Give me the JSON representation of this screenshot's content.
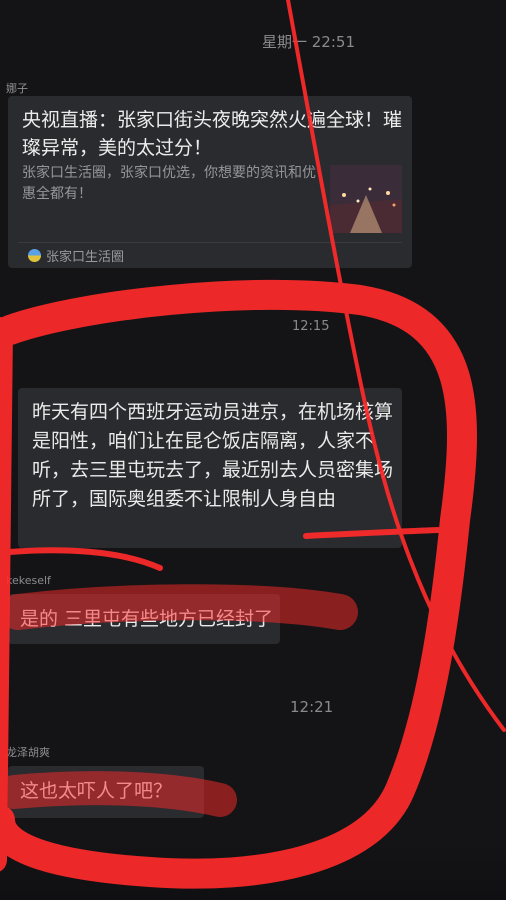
{
  "timestamps": {
    "top": "星期一 22:51",
    "mid1": "12:15",
    "mid2": "12:21"
  },
  "senders": {
    "card_sender": "娜子",
    "msg2_sender": "kekeself",
    "msg3_sender": "龙泽胡爽"
  },
  "card": {
    "title": "央视直播：张家口街头夜晚突然火遍全球！璀璨异常，美的太过分！",
    "description": "张家口生活圈，张家口优选，你想要的资讯和优惠全都有！",
    "source": "张家口生活圈"
  },
  "messages": [
    "昨天有四个西班牙运动员进京，在机场核算是阳性，咱们让在昆仑饭店隔离，人家不听，去三里屯玩去了，最近别去人员密集场所了，国际奥组委不让限制人身自由",
    "是的 三里屯有些地方已经封了",
    "这也太吓人了吧？"
  ],
  "colors": {
    "background": "#141416",
    "bubble": "#2a2b2f",
    "annotation_red": "#ff2a2a"
  }
}
